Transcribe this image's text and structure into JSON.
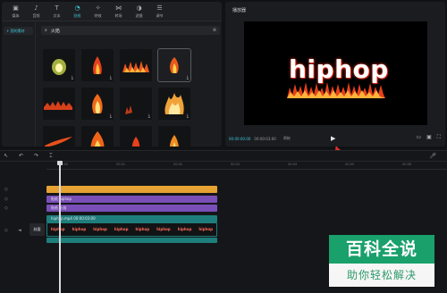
{
  "toolbar": {
    "items": [
      {
        "label": "媒体",
        "icon": "media-icon",
        "glyph": "▣"
      },
      {
        "label": "音频",
        "icon": "audio-icon",
        "glyph": "♪"
      },
      {
        "label": "文本",
        "icon": "text-icon",
        "glyph": "T"
      },
      {
        "label": "贴纸",
        "icon": "sticker-icon",
        "glyph": "◔"
      },
      {
        "label": "特效",
        "icon": "effects-icon",
        "glyph": "✧"
      },
      {
        "label": "转场",
        "icon": "transition-icon",
        "glyph": "⋈"
      },
      {
        "label": "滤镜",
        "icon": "filter-icon",
        "glyph": "◑"
      },
      {
        "label": "调节",
        "icon": "adjust-icon",
        "glyph": "☰"
      }
    ],
    "active_index": 3
  },
  "sidebar": {
    "item_label": "+ 我的素材"
  },
  "search": {
    "query": "火焰"
  },
  "player": {
    "title": "播放器",
    "overlay_text": "hiphop",
    "current_time": "00:00:00:00",
    "duration": "00:00:03:00",
    "ratio": "原始"
  },
  "timeline": {
    "ticks": [
      "00:00",
      "00:01",
      "00:02",
      "00:03",
      "00:04",
      "00:05",
      "00:06"
    ],
    "track_orange": "",
    "track_purple1": "贴纸 hiphop",
    "track_purple2": "贴纸 火焰",
    "track_teal": "hiphop.mp4  00:00:03:00",
    "film_frame": "hiphop",
    "cover_label": "封面"
  },
  "watermark": {
    "top": "百科全说",
    "bottom": "助你轻松解决"
  },
  "colors": {
    "accent": "#3ec6d8",
    "orange": "#e6a232",
    "purple": "#7a4fb7",
    "teal": "#1e7e7c",
    "arrow": "#e0302a",
    "watermark": "#19a06b"
  }
}
